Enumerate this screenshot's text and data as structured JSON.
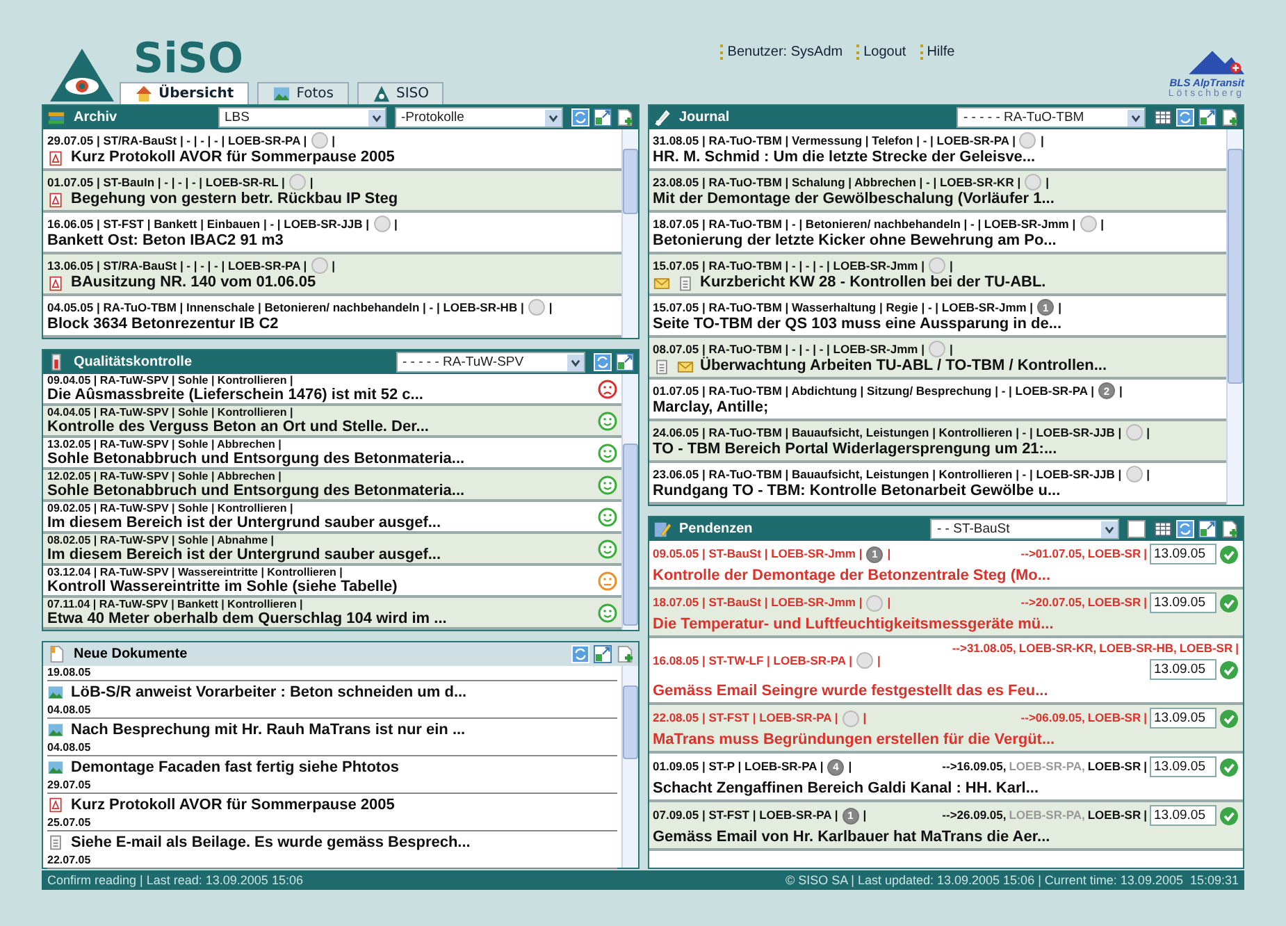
{
  "header": {
    "app_name": "SiSO",
    "tabs": [
      {
        "label": "Übersicht",
        "selected": true
      },
      {
        "label": "Fotos",
        "selected": false
      },
      {
        "label": "SISO",
        "selected": false
      }
    ],
    "links": [
      "Benutzer: SysAdm",
      "Logout",
      "Hilfe"
    ],
    "partner_logo": {
      "name": "BLS AlpTransit",
      "subtitle": "Lötschberg"
    }
  },
  "archiv": {
    "title": "Archiv",
    "filters": [
      "LBS",
      "-Protokolle"
    ],
    "rows": [
      {
        "meta": "29.07.05 | ST/RA-BauSt | - | - | - | LOEB-SR-PA |",
        "meta_end": "|",
        "title": "Kurz Protokoll AVOR für Sommerpause 2005",
        "kind": "pdf"
      },
      {
        "meta": "01.07.05 | ST-BauIn | - | - | - | LOEB-SR-RL |",
        "meta_end": "|",
        "title": "Begehung von gestern betr. Rückbau IP Steg",
        "kind": "pdf"
      },
      {
        "meta": "16.06.05 | ST-FST | Bankett | Einbauen | - | LOEB-SR-JJB |",
        "meta_end": "|",
        "title": "Bankett Ost: Beton IBAC2 91 m3"
      },
      {
        "meta": "13.06.05 | ST/RA-BauSt | - | - | - | LOEB-SR-PA |",
        "meta_end": "|",
        "title": "BAusitzung NR. 140 vom 01.06.05",
        "kind": "pdf"
      },
      {
        "meta": "04.05.05 | RA-TuO-TBM | Innenschale | Betonieren/ nachbehandeln | - | LOEB-SR-HB |",
        "meta_end": "|",
        "title": "Block 3634 Betonrezentur IB C2"
      }
    ]
  },
  "quality": {
    "title": "Qualitätskontrolle",
    "filter": "- - - - - RA-TuW-SPV",
    "rows": [
      {
        "meta": "09.04.05 | RA-TuW-SPV | Sohle | Kontrollieren |",
        "title": "Die Aûsmassbreite (Lieferschein 1476) ist mit 52 c...",
        "kind": "sad"
      },
      {
        "meta": "04.04.05 | RA-TuW-SPV | Sohle | Kontrollieren |",
        "title": "Kontrolle des Verguss Beton an Ort und Stelle. Der...",
        "kind": "happy"
      },
      {
        "meta": "13.02.05 | RA-TuW-SPV | Sohle | Abbrechen |",
        "title": "Sohle Betonabbruch und Entsorgung des Betonmateria...",
        "kind": "happy"
      },
      {
        "meta": "12.02.05 | RA-TuW-SPV | Sohle | Abbrechen |",
        "title": "Sohle Betonabbruch und Entsorgung des Betonmateria...",
        "kind": "happy"
      },
      {
        "meta": "09.02.05 | RA-TuW-SPV | Sohle | Kontrollieren |",
        "title": "Im diesem Bereich ist der Untergrund sauber ausgef...",
        "kind": "happy"
      },
      {
        "meta": "08.02.05 | RA-TuW-SPV | Sohle | Abnahme |",
        "title": "Im diesem Bereich ist der Untergrund sauber ausgef...",
        "kind": "happy"
      },
      {
        "meta": "03.12.04 | RA-TuW-SPV | Wassereintritte | Kontrollieren |",
        "title": "Kontroll Wassereintritte im Sohle (siehe Tabelle)",
        "kind": "neutral"
      },
      {
        "meta": "07.11.04 | RA-TuW-SPV | Bankett | Kontrollieren |",
        "title": "Etwa 40 Meter oberhalb dem Querschlag 104 wird im ...",
        "kind": "happy"
      }
    ]
  },
  "new_documents": {
    "title": "Neue Dokumente",
    "rows": [
      {
        "date": "19.08.05",
        "title": "LöB-S/R anweist Vorarbeiter : Beton schneiden um d...",
        "kind": "photo"
      },
      {
        "date": "04.08.05",
        "title": "Nach Besprechung mit Hr. Rauh MaTrans ist nur ein ...",
        "kind": "photo"
      },
      {
        "date": "04.08.05",
        "title": "Demontage Facaden fast fertig siehe Phtotos",
        "kind": "photo"
      },
      {
        "date": "29.07.05",
        "title": "Kurz Protokoll AVOR für Sommerpause 2005",
        "kind": "pdf"
      },
      {
        "date": "25.07.05",
        "title": "Siehe E-mail als Beilage. Es wurde gemäss Besprech...",
        "kind": "doc"
      },
      {
        "date": "22.07.05"
      }
    ]
  },
  "journal": {
    "title": "Journal",
    "filter": "- - - - - RA-TuO-TBM",
    "rows": [
      {
        "meta": "31.08.05 | RA-TuO-TBM | Vermessung | Telefon | - | LOEB-SR-PA |",
        "meta_end": "|",
        "title": "HR. M. Schmid : Um die letzte Strecke der Geleisve..."
      },
      {
        "meta": "23.08.05 | RA-TuO-TBM | Schalung | Abbrechen | - | LOEB-SR-KR |",
        "meta_end": "|",
        "title": "Mit der Demontage der Gewölbeschalung (Vorläufer 1..."
      },
      {
        "meta": "18.07.05 | RA-TuO-TBM | - | Betonieren/ nachbehandeln | - | LOEB-SR-Jmm |",
        "meta_end": "|",
        "title": "Betonierung der letzte Kicker ohne Bewehrung am Po..."
      },
      {
        "meta": "15.07.05 | RA-TuO-TBM | - | - | - | LOEB-SR-Jmm |",
        "meta_end": "|",
        "title": "Kurzbericht KW 28 - Kontrollen bei der TU-ABL.",
        "attachments": [
          {
            "kind": "mail"
          },
          {
            "kind": "doc"
          }
        ]
      },
      {
        "meta": "15.07.05 | RA-TuO-TBM | Wasserhaltung | Regie | - | LOEB-SR-Jmm |",
        "badge": "1",
        "meta_end": "|",
        "title": "Seite TO-TBM der QS 103 muss eine Aussparung in de..."
      },
      {
        "meta": "08.07.05 | RA-TuO-TBM | - | - | - | LOEB-SR-Jmm |",
        "meta_end": "|",
        "title": "Überwachtung Arbeiten TU-ABL / TO-TBM / Kontrollen...",
        "attachments": [
          {
            "kind": "doc"
          },
          {
            "kind": "mail"
          }
        ]
      },
      {
        "meta": "01.07.05 | RA-TuO-TBM | Abdichtung | Sitzung/ Besprechung | - | LOEB-SR-PA |",
        "badge": "2",
        "meta_end": "|",
        "title": "Marclay, Antille;"
      },
      {
        "meta": "24.06.05 | RA-TuO-TBM | Bauaufsicht, Leistungen | Kontrollieren | - | LOEB-SR-JJB |",
        "meta_end": "|",
        "title": "TO - TBM Bereich Portal Widerlagersprengung um 21:..."
      },
      {
        "meta": "23.06.05 | RA-TuO-TBM | Bauaufsicht, Leistungen | Kontrollieren | - | LOEB-SR-JJB |",
        "meta_end": "|",
        "title": "Rundgang TO - TBM: Kontrolle Betonarbeit Gewölbe u..."
      }
    ]
  },
  "pendenzen": {
    "title": "Pendenzen",
    "filter": "- - ST-BauSt",
    "checkbox": {
      "checked": false
    },
    "rows": [
      {
        "meta": "09.05.05 | ST-BauSt | LOEB-SR-Jmm |",
        "badge": "1",
        "meta_end": "|",
        "target": "-->01.07.05,",
        "assignees": [
          {
            "name": "LOEB-SR",
            "done": false
          }
        ],
        "sep": "|",
        "date": "13.09.05",
        "title": "Kontrolle der Demontage der Betonzentrale Steg (Mo...",
        "overdue": true
      },
      {
        "meta": "18.07.05 | ST-BauSt | LOEB-SR-Jmm |",
        "meta_end": "|",
        "target": "-->20.07.05,",
        "assignees": [
          {
            "name": "LOEB-SR",
            "done": false
          }
        ],
        "sep": "|",
        "date": "13.09.05",
        "title": "Die Temperatur- und Luftfeuchtigkeitsmessgeräte mü...",
        "overdue": true
      },
      {
        "meta": "16.08.05 | ST-TW-LF | LOEB-SR-PA |",
        "meta_end": "|",
        "target": "-->31.08.05,",
        "assignees": [
          {
            "name": "LOEB-SR-KR,",
            "done": false
          },
          {
            "name": "LOEB-SR-HB,",
            "done": false
          },
          {
            "name": "LOEB-SR",
            "done": false
          }
        ],
        "sep": "|",
        "date": "13.09.05",
        "title": "Gemäss Email Seingre wurde festgestellt das es Feu...",
        "overdue": true
      },
      {
        "meta": "22.08.05 | ST-FST | LOEB-SR-PA |",
        "meta_end": "|",
        "target": "-->06.09.05,",
        "assignees": [
          {
            "name": "LOEB-SR",
            "done": false
          }
        ],
        "sep": "|",
        "date": "13.09.05",
        "title": "MaTrans muss Begründungen erstellen für die Vergüt...",
        "overdue": true
      },
      {
        "meta": "01.09.05 | ST-P | LOEB-SR-PA |",
        "badge": "4",
        "meta_end": "|",
        "target": "-->16.09.05,",
        "assignees": [
          {
            "name": "LOEB-SR-PA,",
            "done": true
          },
          {
            "name": "LOEB-SR",
            "done": false
          }
        ],
        "sep": "|",
        "date": "13.09.05",
        "title": "Schacht Zengaffinen Bereich Galdi Kanal : HH. Karl...",
        "overdue": false
      },
      {
        "meta": "07.09.05 | ST-FST | LOEB-SR-PA |",
        "badge": "1",
        "meta_end": "|",
        "target": "-->26.09.05,",
        "assignees": [
          {
            "name": "LOEB-SR-PA,",
            "done": true
          },
          {
            "name": "LOEB-SR",
            "done": false
          }
        ],
        "sep": "|",
        "date": "13.09.05",
        "title": "Gemäss Email von Hr. Karlbauer hat MaTrans die Aer...",
        "overdue": false
      }
    ]
  },
  "status_bar": {
    "left": "Confirm reading | Last read: 13.09.2005 15:06",
    "right": "© SISO SA | Last updated: 13.09.2005 15:06 | Current time: 13.09.2005  15:09:31"
  }
}
